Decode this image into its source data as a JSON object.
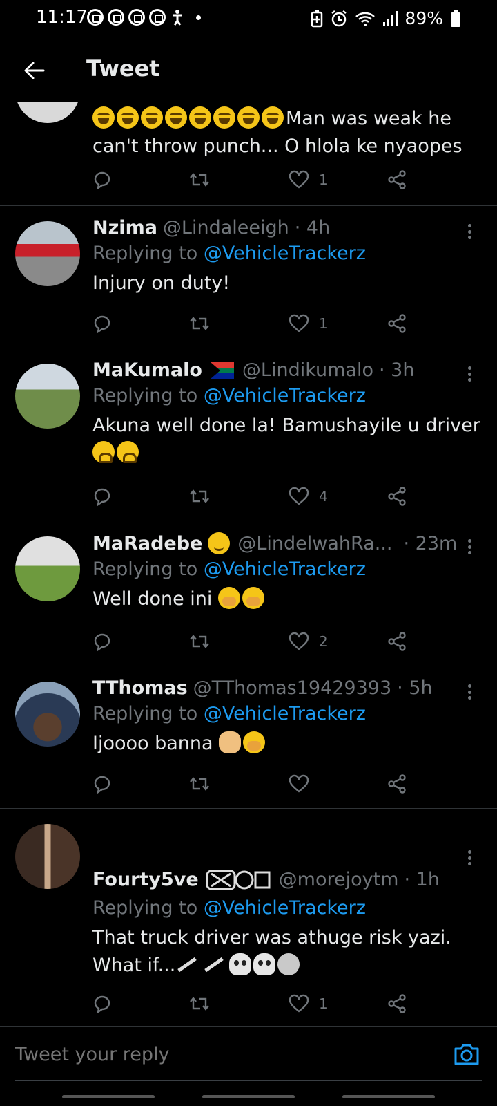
{
  "status_bar": {
    "time": "11:17",
    "battery": "89%"
  },
  "header": {
    "title": "Tweet",
    "back_icon": "back-arrow-icon"
  },
  "tweets": [
    {
      "text": "Man was weak he can't throw punch... O hlola ke nyaopes",
      "emojis": [
        "laugh",
        "laugh",
        "laugh",
        "laugh",
        "laugh",
        "rofl",
        "rofl",
        "rofl"
      ],
      "likes": "1"
    },
    {
      "name": "Nzima",
      "handle": "@Lindaleeigh",
      "time": "· 4h",
      "replying_prefix": "Replying to",
      "replying_to": "@VehicleTrackerz",
      "text": "Injury on duty!",
      "likes": "1"
    },
    {
      "name": "MaKumalo",
      "handle": "@Lindikumalo",
      "time": "· 3h",
      "replying_prefix": "Replying to",
      "replying_to": "@VehicleTrackerz",
      "text": "Akuna well done la! Bamushayile u driver",
      "likes": "4"
    },
    {
      "name": "MaRadebe",
      "handle": "@LindelwahRa...",
      "time": "· 23m",
      "replying_prefix": "Replying to",
      "replying_to": "@VehicleTrackerz",
      "text": "Well done ini",
      "likes": "2"
    },
    {
      "name": "TThomas",
      "handle": "@TThomas19429393",
      "time": "· 5h",
      "replying_prefix": "Replying to",
      "replying_to": "@VehicleTrackerz",
      "text": "Ijoooo banna",
      "likes": ""
    },
    {
      "name": "Fourty5ve",
      "handle": "@morejoytm",
      "time": "· 1h",
      "replying_prefix": "Replying to",
      "replying_to": "@VehicleTrackerz",
      "text_line1": "That truck driver was athuge risk yazi.",
      "text_line2": "What if...",
      "likes": "1"
    }
  ],
  "reply_bar": {
    "placeholder": "Tweet your reply",
    "camera_icon": "camera-icon"
  },
  "colors": {
    "background": "#000000",
    "text": "#e7e9ea",
    "muted": "#71767b",
    "accent": "#1d9bf0",
    "divider": "#2f3336"
  }
}
